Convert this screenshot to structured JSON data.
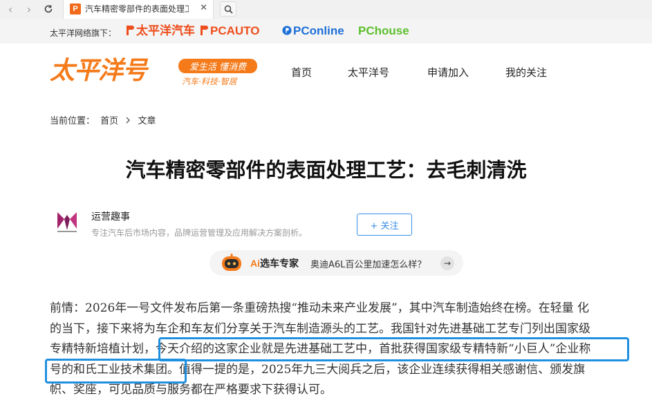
{
  "browser": {
    "tab_title": "汽车精密零部件的表面处理工艺",
    "tab_favicon_letter": "P",
    "back_glyph": "‹",
    "forward_glyph": "›",
    "close_glyph": "✕"
  },
  "network": {
    "label": "太平洋网络旗下：",
    "logos": [
      "太平洋汽车",
      "PCAUTO",
      "PConline",
      "PChouse"
    ]
  },
  "header": {
    "logo": "太平洋号",
    "slogan": "爱生活 懂消费",
    "slogan_sub": "汽车·科技·智居",
    "nav": [
      "首页",
      "太平洋号",
      "申请加入",
      "我的关注"
    ]
  },
  "breadcrumb": {
    "label": "当前位置：",
    "items": [
      "首页",
      "文章"
    ]
  },
  "article": {
    "title": "汽车精密零部件的表面处理工艺：去毛刺清洗",
    "author_name": "运营趣事",
    "author_desc": "专注汽车后市场内容，品牌运营管理及应用解决方案剖析。",
    "follow_label": "+ 关注",
    "lines": [
      "前情：2026年一号文件发布后第一条重磅热搜“推动未来产业发展”，其中汽车制造始终在榜。在轻量 化",
      "的当下，接下来将为车企和车友们分享关于汽车制造源头的工艺。我国针对先进基础工艺专门列出国家级",
      "专精特新培植计划，今天介绍的这家企业就是先进基础工艺中，首批获得国家级专精特新“小巨人”企业称",
      "号的和氏工业技术集团。值得一提的是，2025年九三大阅兵之后，该企业连续获得相关感谢信、颁发旗",
      "帜、奖座，可见品质与服务都在严格要求下获得认可。"
    ]
  },
  "ai_bar": {
    "brand_ai": "Ai",
    "brand_rest": "选车专家",
    "question": "奥迪A6L百公里加速怎么样？",
    "go_glyph": "→"
  },
  "colors": {
    "brand_orange": "#f47a1a",
    "highlight_blue": "#1f8fe0",
    "follow_blue": "#3a8ee6"
  }
}
